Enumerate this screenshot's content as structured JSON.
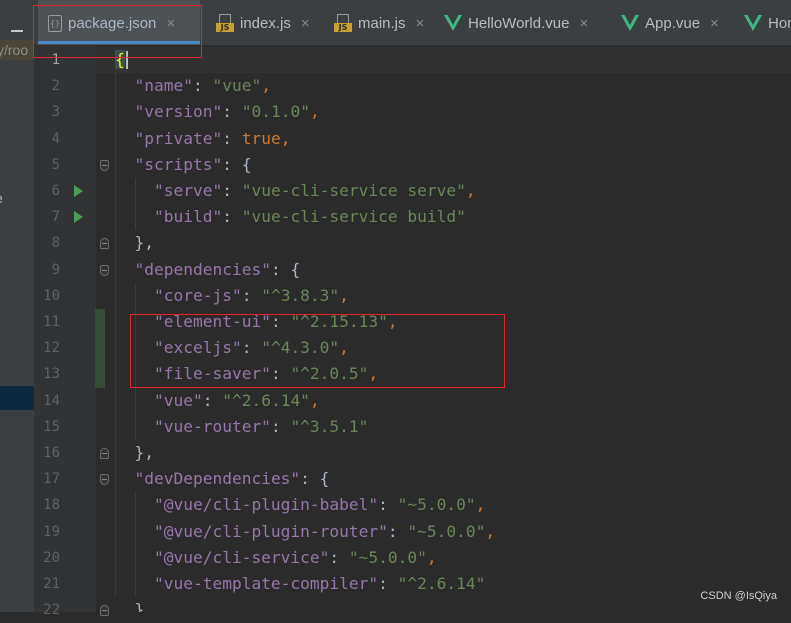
{
  "left_panel": {
    "path_fragment": "y/roo",
    "item_fragment": "e"
  },
  "tabs": [
    {
      "label": "package.json",
      "icon": "json-file-icon",
      "active": true
    },
    {
      "label": "index.js",
      "icon": "js-file-icon",
      "active": false
    },
    {
      "label": "main.js",
      "icon": "js-file-icon",
      "active": false
    },
    {
      "label": "HelloWorld.vue",
      "icon": "vue-file-icon",
      "active": false
    },
    {
      "label": "App.vue",
      "icon": "vue-file-icon",
      "active": false
    },
    {
      "label": "Hom",
      "icon": "vue-file-icon",
      "active": false
    }
  ],
  "close_glyph": "×",
  "editor": {
    "current_line": 1,
    "lines": [
      {
        "n": "1",
        "tokens": [
          {
            "t": "{",
            "c": "brace"
          }
        ]
      },
      {
        "n": "2",
        "tokens": [
          {
            "t": "  ",
            "c": ""
          },
          {
            "t": "\"name\"",
            "c": "k"
          },
          {
            "t": ": ",
            "c": ""
          },
          {
            "t": "\"vue\"",
            "c": "s"
          },
          {
            "t": ",",
            "c": "p"
          }
        ]
      },
      {
        "n": "3",
        "tokens": [
          {
            "t": "  ",
            "c": ""
          },
          {
            "t": "\"version\"",
            "c": "k"
          },
          {
            "t": ": ",
            "c": ""
          },
          {
            "t": "\"0.1.0\"",
            "c": "s"
          },
          {
            "t": ",",
            "c": "p"
          }
        ]
      },
      {
        "n": "4",
        "tokens": [
          {
            "t": "  ",
            "c": ""
          },
          {
            "t": "\"private\"",
            "c": "k"
          },
          {
            "t": ": ",
            "c": ""
          },
          {
            "t": "true",
            "c": "b"
          },
          {
            "t": ",",
            "c": "p"
          }
        ]
      },
      {
        "n": "5",
        "tokens": [
          {
            "t": "  ",
            "c": ""
          },
          {
            "t": "\"scripts\"",
            "c": "k"
          },
          {
            "t": ": {",
            "c": ""
          }
        ]
      },
      {
        "n": "6",
        "tokens": [
          {
            "t": "    ",
            "c": ""
          },
          {
            "t": "\"serve\"",
            "c": "k"
          },
          {
            "t": ": ",
            "c": ""
          },
          {
            "t": "\"vue-cli-service serve\"",
            "c": "s"
          },
          {
            "t": ",",
            "c": "p"
          }
        ]
      },
      {
        "n": "7",
        "tokens": [
          {
            "t": "    ",
            "c": ""
          },
          {
            "t": "\"build\"",
            "c": "k"
          },
          {
            "t": ": ",
            "c": ""
          },
          {
            "t": "\"vue-cli-service build\"",
            "c": "s"
          }
        ]
      },
      {
        "n": "8",
        "tokens": [
          {
            "t": "  },",
            "c": ""
          }
        ]
      },
      {
        "n": "9",
        "tokens": [
          {
            "t": "  ",
            "c": ""
          },
          {
            "t": "\"dependencies\"",
            "c": "k"
          },
          {
            "t": ": {",
            "c": ""
          }
        ]
      },
      {
        "n": "10",
        "tokens": [
          {
            "t": "    ",
            "c": ""
          },
          {
            "t": "\"core-js\"",
            "c": "k"
          },
          {
            "t": ": ",
            "c": ""
          },
          {
            "t": "\"^3.8.3\"",
            "c": "s"
          },
          {
            "t": ",",
            "c": "p"
          }
        ]
      },
      {
        "n": "11",
        "tokens": [
          {
            "t": "    ",
            "c": ""
          },
          {
            "t": "\"element-ui\"",
            "c": "k"
          },
          {
            "t": ": ",
            "c": ""
          },
          {
            "t": "\"^2.15.13\"",
            "c": "s"
          },
          {
            "t": ",",
            "c": "p"
          }
        ]
      },
      {
        "n": "12",
        "tokens": [
          {
            "t": "    ",
            "c": ""
          },
          {
            "t": "\"exceljs\"",
            "c": "k"
          },
          {
            "t": ": ",
            "c": ""
          },
          {
            "t": "\"^4.3.0\"",
            "c": "s"
          },
          {
            "t": ",",
            "c": "p"
          }
        ]
      },
      {
        "n": "13",
        "tokens": [
          {
            "t": "    ",
            "c": ""
          },
          {
            "t": "\"file-saver\"",
            "c": "k"
          },
          {
            "t": ": ",
            "c": ""
          },
          {
            "t": "\"^2.0.5\"",
            "c": "s"
          },
          {
            "t": ",",
            "c": "p"
          }
        ]
      },
      {
        "n": "14",
        "tokens": [
          {
            "t": "    ",
            "c": ""
          },
          {
            "t": "\"vue\"",
            "c": "k"
          },
          {
            "t": ": ",
            "c": ""
          },
          {
            "t": "\"^2.6.14\"",
            "c": "s"
          },
          {
            "t": ",",
            "c": "p"
          }
        ]
      },
      {
        "n": "15",
        "tokens": [
          {
            "t": "    ",
            "c": ""
          },
          {
            "t": "\"vue-router\"",
            "c": "k"
          },
          {
            "t": ": ",
            "c": ""
          },
          {
            "t": "\"^3.5.1\"",
            "c": "s"
          }
        ]
      },
      {
        "n": "16",
        "tokens": [
          {
            "t": "  },",
            "c": ""
          }
        ]
      },
      {
        "n": "17",
        "tokens": [
          {
            "t": "  ",
            "c": ""
          },
          {
            "t": "\"devDependencies\"",
            "c": "k"
          },
          {
            "t": ": {",
            "c": ""
          }
        ]
      },
      {
        "n": "18",
        "tokens": [
          {
            "t": "    ",
            "c": ""
          },
          {
            "t": "\"@vue/cli-plugin-babel\"",
            "c": "k"
          },
          {
            "t": ": ",
            "c": ""
          },
          {
            "t": "\"~5.0.0\"",
            "c": "s"
          },
          {
            "t": ",",
            "c": "p"
          }
        ]
      },
      {
        "n": "19",
        "tokens": [
          {
            "t": "    ",
            "c": ""
          },
          {
            "t": "\"@vue/cli-plugin-router\"",
            "c": "k"
          },
          {
            "t": ": ",
            "c": ""
          },
          {
            "t": "\"~5.0.0\"",
            "c": "s"
          },
          {
            "t": ",",
            "c": "p"
          }
        ]
      },
      {
        "n": "20",
        "tokens": [
          {
            "t": "    ",
            "c": ""
          },
          {
            "t": "\"@vue/cli-service\"",
            "c": "k"
          },
          {
            "t": ": ",
            "c": ""
          },
          {
            "t": "\"~5.0.0\"",
            "c": "s"
          },
          {
            "t": ",",
            "c": "p"
          }
        ]
      },
      {
        "n": "21",
        "tokens": [
          {
            "t": "    ",
            "c": ""
          },
          {
            "t": "\"vue-template-compiler\"",
            "c": "k"
          },
          {
            "t": ": ",
            "c": ""
          },
          {
            "t": "\"^2.6.14\"",
            "c": "s"
          }
        ]
      },
      {
        "n": "22",
        "tokens": [
          {
            "t": "  }",
            "c": ""
          }
        ]
      }
    ]
  },
  "watermark": "CSDN @IsQiya",
  "colors": {
    "keys": "#9876aa",
    "strings": "#6a8759",
    "keywords": "#cc7832",
    "annotation": "#e0252b",
    "active_tab_underline": "#4a88c7"
  }
}
